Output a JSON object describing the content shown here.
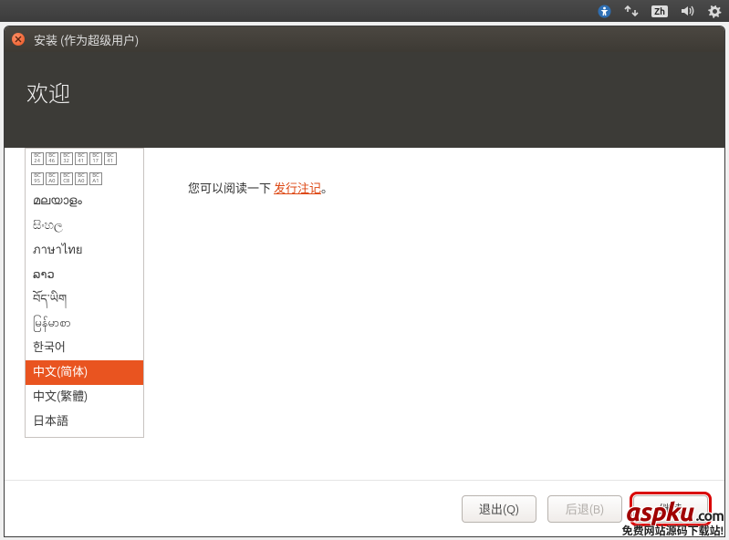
{
  "topbar": {
    "input_indicator": "Zh"
  },
  "window": {
    "title": "安装 (作为超级用户)",
    "welcome": "欢迎"
  },
  "notes": {
    "prefix": "您可以阅读一下 ",
    "link": "发行注记",
    "suffix": "。"
  },
  "languages": [
    {
      "label": "മലയാളം",
      "selected": false
    },
    {
      "label": "සිංහල",
      "selected": false
    },
    {
      "label": "ภาษาไทย",
      "selected": false
    },
    {
      "label": "ລາວ",
      "selected": false
    },
    {
      "label": "བོད་ཡིག",
      "selected": false
    },
    {
      "label": "မြန်မာစာ",
      "selected": false
    },
    {
      "label": "한국어",
      "selected": false
    },
    {
      "label": "中文(简体)",
      "selected": true
    },
    {
      "label": "中文(繁體)",
      "selected": false
    },
    {
      "label": "日本語",
      "selected": false
    }
  ],
  "buttons": {
    "quit": "退出(Q)",
    "back": "后退(B)",
    "continue": "继续"
  },
  "watermark": {
    "brand": "aspku",
    "suffix": ".com",
    "tagline": "免费网站源码下载站!"
  }
}
